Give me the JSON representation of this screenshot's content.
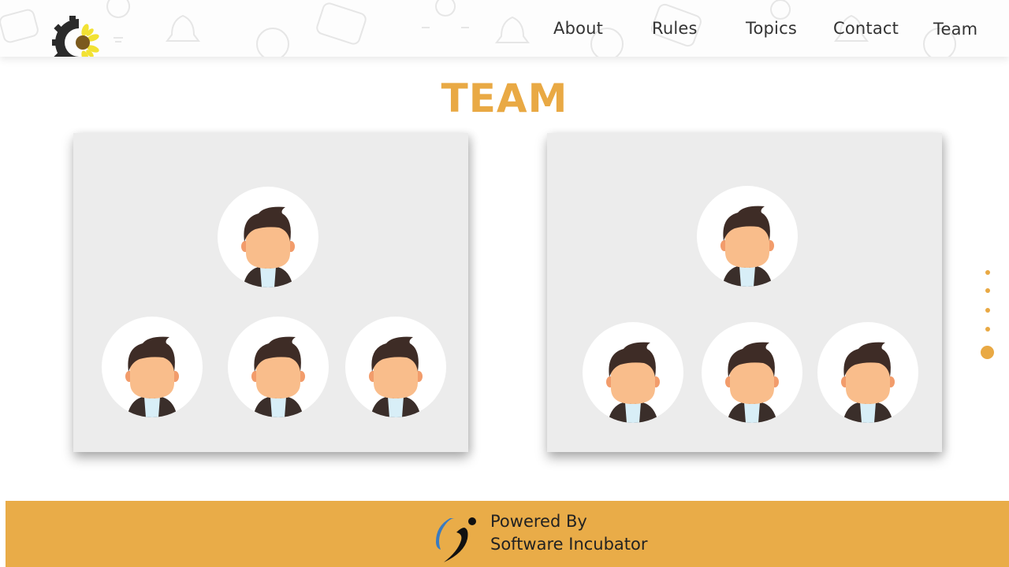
{
  "header": {
    "logo_icon": "gear-sunflower-logo",
    "nav": [
      {
        "label": "About"
      },
      {
        "label": "Rules"
      },
      {
        "label": "Topics"
      },
      {
        "label": "Contact"
      },
      {
        "label": "Team"
      }
    ]
  },
  "main": {
    "title": "TEAM",
    "cards": [
      {
        "members": [
          {
            "avatar_icon": "person-avatar-icon"
          },
          {
            "avatar_icon": "person-avatar-icon"
          },
          {
            "avatar_icon": "person-avatar-icon"
          },
          {
            "avatar_icon": "person-avatar-icon"
          }
        ]
      },
      {
        "members": [
          {
            "avatar_icon": "person-avatar-icon"
          },
          {
            "avatar_icon": "person-avatar-icon"
          },
          {
            "avatar_icon": "person-avatar-icon"
          },
          {
            "avatar_icon": "person-avatar-icon"
          }
        ]
      }
    ]
  },
  "pager": {
    "dot_count": 5,
    "active_index": 4
  },
  "footer": {
    "powered_by": "Powered By",
    "company": "Software Incubator",
    "logo_icon": "software-incubator-logo"
  },
  "colors": {
    "accent": "#e9a944",
    "card_background": "#ececec",
    "footer_background": "#e9ac48",
    "hair": "#3e2c26",
    "skin": "#f9bd8b",
    "jacket": "#3a2e2a",
    "shirt": "#d8eef7"
  }
}
